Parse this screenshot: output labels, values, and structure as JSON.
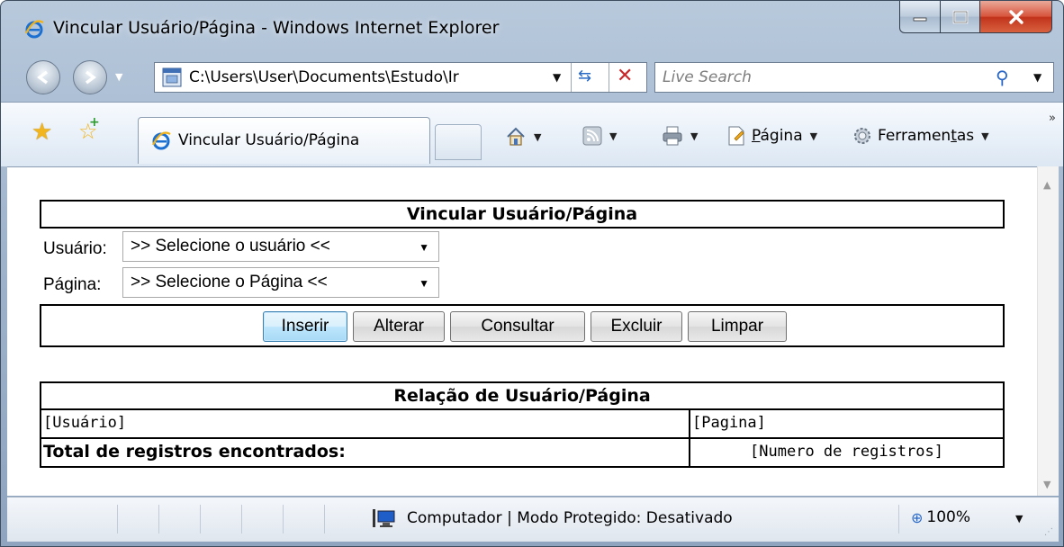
{
  "window": {
    "title": "Vincular Usuário/Página - Windows Internet Explorer"
  },
  "address_bar": {
    "url": "C:\\Users\\User\\Documents\\Estudo\\Ir"
  },
  "search": {
    "placeholder": "Live Search"
  },
  "tab": {
    "label": "Vincular Usuário/Página"
  },
  "commands": {
    "page_label_pre": "",
    "page_label_u": "P",
    "page_label_post": "ágina",
    "tools_label_pre": "Ferramen",
    "tools_label_u": "t",
    "tools_label_post": "as"
  },
  "form": {
    "title": "Vincular Usuário/Página",
    "user_label": "Usuário:",
    "user_select_value": ">> Selecione o usuário <<",
    "page_label": "Página:",
    "page_select_value": ">> Selecione o Página <<",
    "buttons": {
      "insert": "Inserir",
      "update": "Alterar",
      "query": "Consultar",
      "delete": "Excluir",
      "clear": "Limpar"
    }
  },
  "table": {
    "title": "Relação de Usuário/Página",
    "col_user": "[Usuário]",
    "col_page": "[Pagina]",
    "total_label": "Total de registros encontrados:",
    "total_value": "[Numero de registros]"
  },
  "status": {
    "zone_text": "Computador | Modo Protegido: Desativado",
    "zoom": "100%"
  }
}
